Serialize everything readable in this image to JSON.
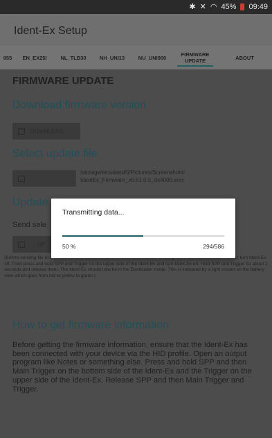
{
  "statusbar": {
    "bt_icon": "bluetooth-icon",
    "mute_icon": "mute-icon",
    "wifi_icon": "wifi-icon",
    "battery": "45%",
    "time": "09:49"
  },
  "appbar": {
    "title": "Ident-Ex Setup"
  },
  "tabs": [
    "955",
    "EN_EX25I",
    "NL_TLB30",
    "NH_UNI13",
    "NU_UNI900",
    "FIRMWARE UPDATE",
    "ABOUT"
  ],
  "active_tab": 5,
  "content": {
    "heading": "FIRMWARE UPDATE",
    "download_title": "Download firmware version",
    "download_btn": "DOWNLOAD",
    "select_title": "Select update file",
    "select_btn": "...",
    "file_path_1": "/storage/emulated/0/Pictures/Screenshots/",
    "file_path_2": "IdentEx_Firmware_v0.51.0.5_0x4000.srec",
    "update_title": "Update",
    "send_label": "Send sele",
    "update_btn": "UP",
    "instructions": "(Before sending file to Ident-Ex, ensure that Ident-Ex is in Bootloader mode. To bring Ident-Ex into Bootloader mode, turn Ident-Ex off. Then press and hold SPP and Trigger on the upper side of the Ident-Ex and turn Ident-Ex on. Hold SPP and Trigger for about 2 seconds and release them. The Ident-Ex should now be in the Bootloader mode. This is indicated by a light chaser on the battery view which goes from red to yellow to green.)",
    "howto_title": "How to get firmware information",
    "howto_text": "Before getting the firmware information, ensure that the Ident-Ex has been connected with your device via the HID profile. Open an output program like Notes or something else. Press and hold SPP and then Main Trigger on the bottom side of the Ident-Ex and the Trigger on the upper side of the Ident-Ex. Release SPP and then Main Trigger and Trigger."
  },
  "dialog": {
    "message": "Transmitting data...",
    "percent_label": "50 %",
    "count_label": "294/586",
    "progress": 0.5
  }
}
